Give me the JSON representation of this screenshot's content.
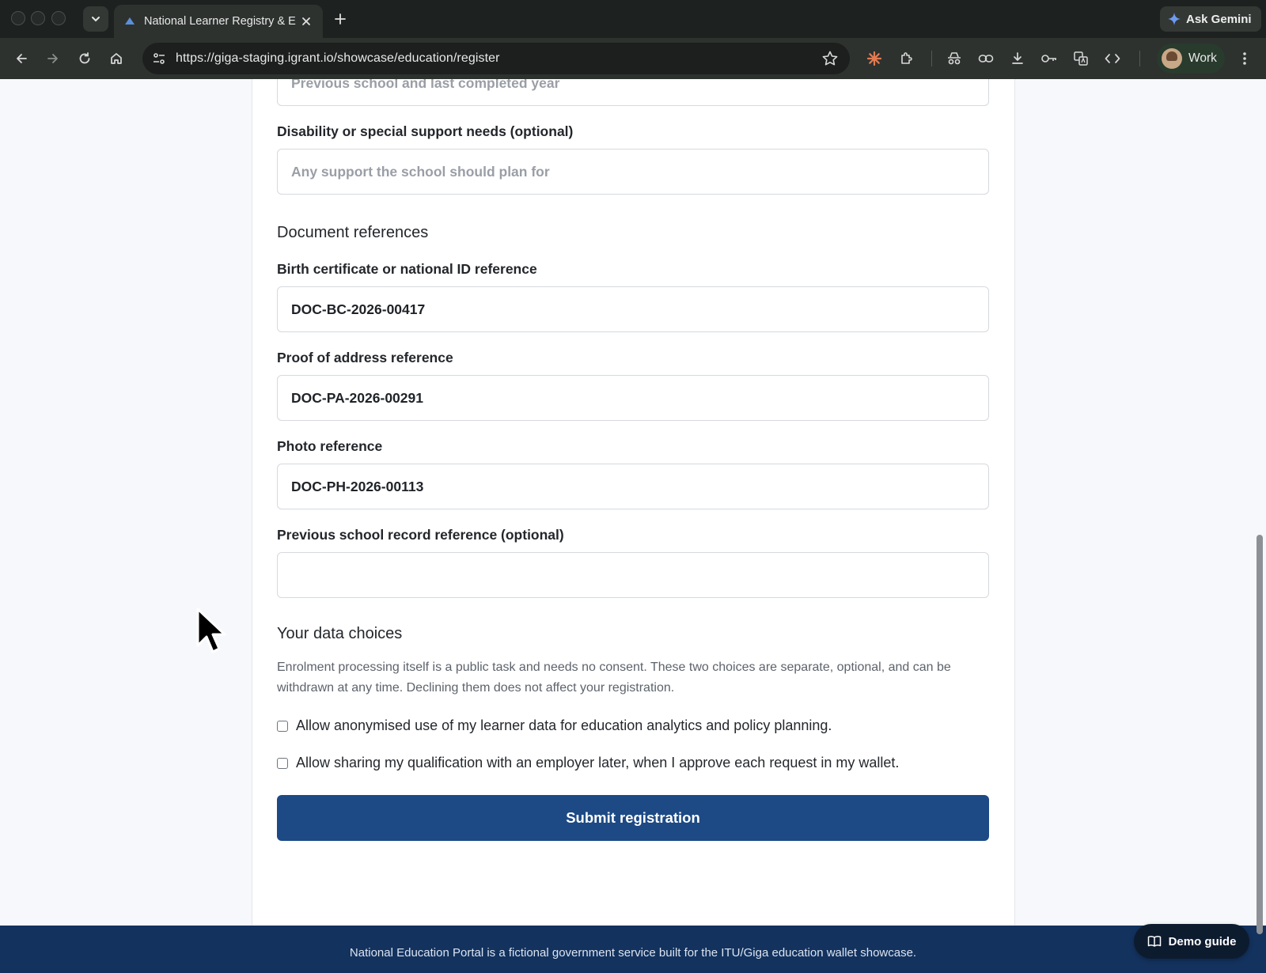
{
  "browser": {
    "tab_title": "National Learner Registry & E",
    "url": "https://giga-staging.igrant.io/showcase/education/register",
    "ask_gemini": "Ask Gemini",
    "profile_name": "Work"
  },
  "form": {
    "previous_school": {
      "placeholder": "Previous school and last completed year"
    },
    "disability": {
      "label": "Disability or special support needs (optional)",
      "placeholder": "Any support the school should plan for"
    },
    "documents_title": "Document references",
    "birth_cert": {
      "label": "Birth certificate or national ID reference",
      "value": "DOC-BC-2026-00417"
    },
    "address": {
      "label": "Proof of address reference",
      "value": "DOC-PA-2026-00291"
    },
    "photo": {
      "label": "Photo reference",
      "value": "DOC-PH-2026-00113"
    },
    "prev_record": {
      "label": "Previous school record reference (optional)",
      "value": ""
    },
    "data_choices_title": "Your data choices",
    "data_choices_help": "Enrolment processing itself is a public task and needs no consent. These two choices are separate, optional, and can be withdrawn at any time. Declining them does not affect your registration.",
    "consent_analytics": "Allow anonymised use of my learner data for education analytics and policy planning.",
    "consent_employer": "Allow sharing my qualification with an employer later, when I approve each request in my wallet.",
    "submit_label": "Submit registration"
  },
  "footer": {
    "text": "National Education Portal is a fictional government service built for the ITU/Giga education wallet showcase."
  },
  "demo_guide": "Demo guide",
  "colors": {
    "primary": "#1d4a85",
    "footer": "#13325e",
    "chrome": "#1d211f"
  }
}
